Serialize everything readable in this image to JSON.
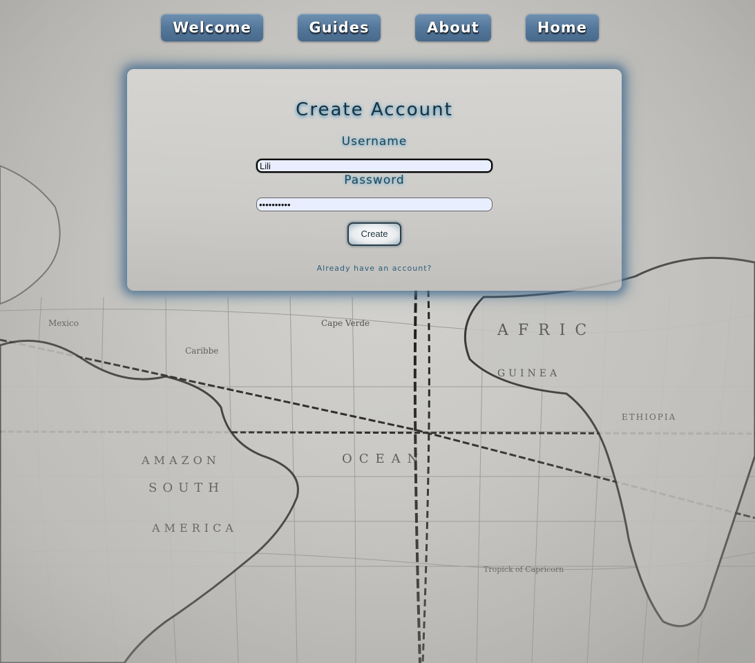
{
  "nav": {
    "items": [
      {
        "label": "Welcome"
      },
      {
        "label": "Guides"
      },
      {
        "label": "About"
      },
      {
        "label": "Home"
      }
    ]
  },
  "form": {
    "title": "Create Account",
    "username_label": "Username",
    "username_value": "Lili",
    "password_label": "Password",
    "password_value": "••••••••••",
    "submit_label": "Create",
    "login_link": "Already have an account?"
  },
  "colors": {
    "nav_button": "#54789b",
    "card_glow": "#4a7091",
    "title_text": "#17323f",
    "input_bg": "#e9eeff"
  }
}
